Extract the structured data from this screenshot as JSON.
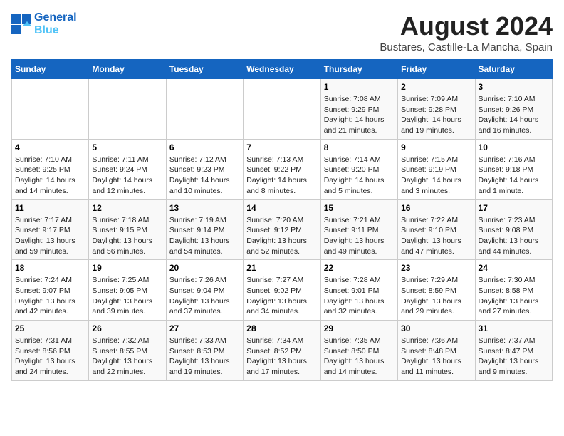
{
  "header": {
    "logo_line1": "General",
    "logo_line2": "Blue",
    "month_year": "August 2024",
    "location": "Bustares, Castille-La Mancha, Spain"
  },
  "weekdays": [
    "Sunday",
    "Monday",
    "Tuesday",
    "Wednesday",
    "Thursday",
    "Friday",
    "Saturday"
  ],
  "weeks": [
    [
      {
        "day": "",
        "content": ""
      },
      {
        "day": "",
        "content": ""
      },
      {
        "day": "",
        "content": ""
      },
      {
        "day": "",
        "content": ""
      },
      {
        "day": "1",
        "content": "Sunrise: 7:08 AM\nSunset: 9:29 PM\nDaylight: 14 hours and 21 minutes."
      },
      {
        "day": "2",
        "content": "Sunrise: 7:09 AM\nSunset: 9:28 PM\nDaylight: 14 hours and 19 minutes."
      },
      {
        "day": "3",
        "content": "Sunrise: 7:10 AM\nSunset: 9:26 PM\nDaylight: 14 hours and 16 minutes."
      }
    ],
    [
      {
        "day": "4",
        "content": "Sunrise: 7:10 AM\nSunset: 9:25 PM\nDaylight: 14 hours and 14 minutes."
      },
      {
        "day": "5",
        "content": "Sunrise: 7:11 AM\nSunset: 9:24 PM\nDaylight: 14 hours and 12 minutes."
      },
      {
        "day": "6",
        "content": "Sunrise: 7:12 AM\nSunset: 9:23 PM\nDaylight: 14 hours and 10 minutes."
      },
      {
        "day": "7",
        "content": "Sunrise: 7:13 AM\nSunset: 9:22 PM\nDaylight: 14 hours and 8 minutes."
      },
      {
        "day": "8",
        "content": "Sunrise: 7:14 AM\nSunset: 9:20 PM\nDaylight: 14 hours and 5 minutes."
      },
      {
        "day": "9",
        "content": "Sunrise: 7:15 AM\nSunset: 9:19 PM\nDaylight: 14 hours and 3 minutes."
      },
      {
        "day": "10",
        "content": "Sunrise: 7:16 AM\nSunset: 9:18 PM\nDaylight: 14 hours and 1 minute."
      }
    ],
    [
      {
        "day": "11",
        "content": "Sunrise: 7:17 AM\nSunset: 9:17 PM\nDaylight: 13 hours and 59 minutes."
      },
      {
        "day": "12",
        "content": "Sunrise: 7:18 AM\nSunset: 9:15 PM\nDaylight: 13 hours and 56 minutes."
      },
      {
        "day": "13",
        "content": "Sunrise: 7:19 AM\nSunset: 9:14 PM\nDaylight: 13 hours and 54 minutes."
      },
      {
        "day": "14",
        "content": "Sunrise: 7:20 AM\nSunset: 9:12 PM\nDaylight: 13 hours and 52 minutes."
      },
      {
        "day": "15",
        "content": "Sunrise: 7:21 AM\nSunset: 9:11 PM\nDaylight: 13 hours and 49 minutes."
      },
      {
        "day": "16",
        "content": "Sunrise: 7:22 AM\nSunset: 9:10 PM\nDaylight: 13 hours and 47 minutes."
      },
      {
        "day": "17",
        "content": "Sunrise: 7:23 AM\nSunset: 9:08 PM\nDaylight: 13 hours and 44 minutes."
      }
    ],
    [
      {
        "day": "18",
        "content": "Sunrise: 7:24 AM\nSunset: 9:07 PM\nDaylight: 13 hours and 42 minutes."
      },
      {
        "day": "19",
        "content": "Sunrise: 7:25 AM\nSunset: 9:05 PM\nDaylight: 13 hours and 39 minutes."
      },
      {
        "day": "20",
        "content": "Sunrise: 7:26 AM\nSunset: 9:04 PM\nDaylight: 13 hours and 37 minutes."
      },
      {
        "day": "21",
        "content": "Sunrise: 7:27 AM\nSunset: 9:02 PM\nDaylight: 13 hours and 34 minutes."
      },
      {
        "day": "22",
        "content": "Sunrise: 7:28 AM\nSunset: 9:01 PM\nDaylight: 13 hours and 32 minutes."
      },
      {
        "day": "23",
        "content": "Sunrise: 7:29 AM\nSunset: 8:59 PM\nDaylight: 13 hours and 29 minutes."
      },
      {
        "day": "24",
        "content": "Sunrise: 7:30 AM\nSunset: 8:58 PM\nDaylight: 13 hours and 27 minutes."
      }
    ],
    [
      {
        "day": "25",
        "content": "Sunrise: 7:31 AM\nSunset: 8:56 PM\nDaylight: 13 hours and 24 minutes."
      },
      {
        "day": "26",
        "content": "Sunrise: 7:32 AM\nSunset: 8:55 PM\nDaylight: 13 hours and 22 minutes."
      },
      {
        "day": "27",
        "content": "Sunrise: 7:33 AM\nSunset: 8:53 PM\nDaylight: 13 hours and 19 minutes."
      },
      {
        "day": "28",
        "content": "Sunrise: 7:34 AM\nSunset: 8:52 PM\nDaylight: 13 hours and 17 minutes."
      },
      {
        "day": "29",
        "content": "Sunrise: 7:35 AM\nSunset: 8:50 PM\nDaylight: 13 hours and 14 minutes."
      },
      {
        "day": "30",
        "content": "Sunrise: 7:36 AM\nSunset: 8:48 PM\nDaylight: 13 hours and 11 minutes."
      },
      {
        "day": "31",
        "content": "Sunrise: 7:37 AM\nSunset: 8:47 PM\nDaylight: 13 hours and 9 minutes."
      }
    ]
  ]
}
